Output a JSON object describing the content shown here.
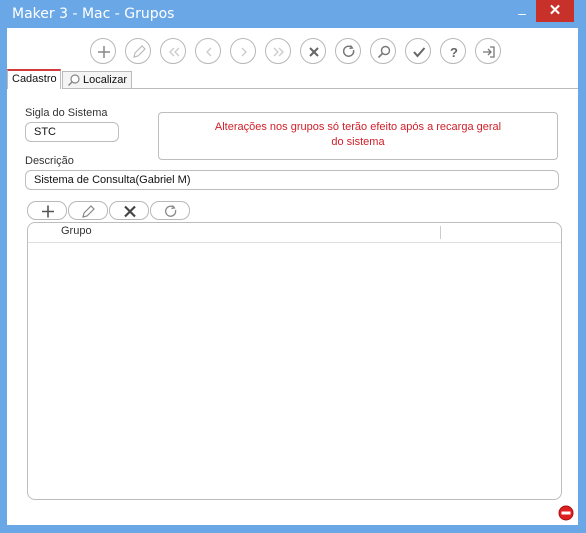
{
  "window": {
    "title": "Maker 3 - Mac - Grupos",
    "minimize_glyph": "–",
    "close_glyph": "✕"
  },
  "toolbar": {
    "buttons": [
      {
        "name": "add-icon"
      },
      {
        "name": "edit-icon"
      },
      {
        "name": "first-record-icon"
      },
      {
        "name": "previous-record-icon"
      },
      {
        "name": "next-record-icon"
      },
      {
        "name": "last-record-icon"
      },
      {
        "name": "delete-icon"
      },
      {
        "name": "refresh-icon"
      },
      {
        "name": "search-icon"
      },
      {
        "name": "confirm-icon"
      },
      {
        "name": "help-icon"
      },
      {
        "name": "exit-icon"
      }
    ]
  },
  "tabs": {
    "cadastro": "Cadastro",
    "localizar": "Localizar"
  },
  "form": {
    "sigla_label": "Sigla do Sistema",
    "sigla_value": "STC",
    "descricao_label": "Descrição",
    "descricao_value": "Sistema de Consulta(Gabriel M)",
    "notice_line1": "Alterações nos grupos só terão efeito após a recarga geral",
    "notice_line2": "do sistema"
  },
  "grid": {
    "column_header": "Grupo",
    "rows": []
  },
  "colors": {
    "title_bar": "#6aa7e6",
    "close_button": "#c7312a",
    "notice_text": "#d0202a",
    "active_tab_accent": "#d23b3b"
  }
}
